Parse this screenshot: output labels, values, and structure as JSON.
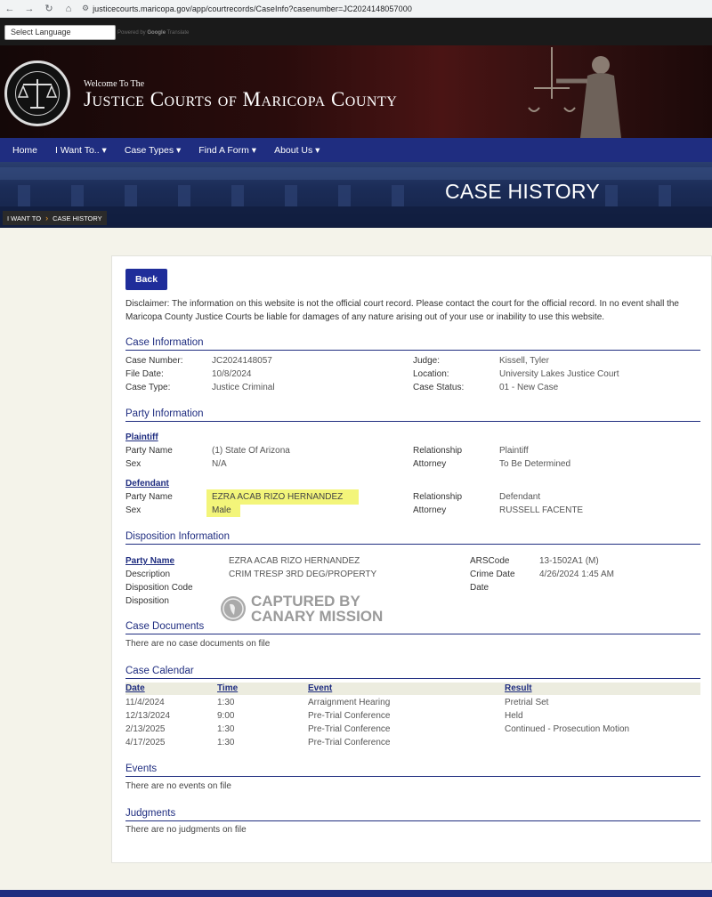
{
  "browser": {
    "url": "justicecourts.maricopa.gov/app/courtrecords/CaseInfo?casenumber=JC2024148057000"
  },
  "translate": {
    "select_label": "Select Language",
    "powered_by": "Powered by",
    "google": "Google",
    "translate": "Translate"
  },
  "header": {
    "welcome": "Welcome To The",
    "title": "Justice Courts of Maricopa County"
  },
  "nav": {
    "items": [
      "Home",
      "I Want To.. ▾",
      "Case Types ▾",
      "Find A Form ▾",
      "About Us ▾"
    ]
  },
  "banner": {
    "title": "CASE HISTORY",
    "breadcrumb": [
      "I WANT TO",
      "CASE HISTORY"
    ]
  },
  "page": {
    "back_label": "Back",
    "disclaimer": "Disclaimer: The information on this website is not the official court record. Please contact the court for the official record. In no event shall the Maricopa County Justice Courts be liable for damages of any nature arising out of your use or inability to use this website."
  },
  "case_info": {
    "title": "Case Information",
    "case_number_label": "Case Number:",
    "case_number": "JC2024148057",
    "file_date_label": "File Date:",
    "file_date": "10/8/2024",
    "case_type_label": "Case Type:",
    "case_type": "Justice Criminal",
    "judge_label": "Judge:",
    "judge": "Kissell, Tyler",
    "location_label": "Location:",
    "location": "University Lakes Justice Court",
    "status_label": "Case Status:",
    "status": "01 - New Case"
  },
  "party_info": {
    "title": "Party Information",
    "plaintiff": {
      "heading": "Plaintiff",
      "party_name_label": "Party Name",
      "party_name": "(1) State Of Arizona",
      "sex_label": "Sex",
      "sex": "N/A",
      "relationship_label": "Relationship",
      "relationship": "Plaintiff",
      "attorney_label": "Attorney",
      "attorney": "To Be Determined"
    },
    "defendant": {
      "heading": "Defendant",
      "party_name_label": "Party Name",
      "party_name": "EZRA ACAB RIZO HERNANDEZ",
      "sex_label": "Sex",
      "sex": "Male",
      "relationship_label": "Relationship",
      "relationship": "Defendant",
      "attorney_label": "Attorney",
      "attorney": "RUSSELL FACENTE"
    }
  },
  "disposition": {
    "title": "Disposition Information",
    "party_name_label": "Party Name",
    "party_name": "EZRA ACAB RIZO HERNANDEZ",
    "description_label": "Description",
    "description": "CRIM TRESP 3RD DEG/PROPERTY",
    "code_label": "Disposition Code",
    "disposition_label": "Disposition",
    "ars_label": "ARSCode",
    "ars": "13-1502A1 (M)",
    "crime_date_label": "Crime Date",
    "crime_date": "4/26/2024 1:45 AM",
    "date_label": "Date"
  },
  "watermark": {
    "line1": "CAPTURED BY",
    "line2": "CANARY MISSION"
  },
  "documents": {
    "title": "Case Documents",
    "empty": "There are no case documents on file"
  },
  "calendar": {
    "title": "Case Calendar",
    "headers": [
      "Date",
      "Time",
      "Event",
      "Result"
    ],
    "rows": [
      [
        "11/4/2024",
        "1:30",
        "Arraignment Hearing",
        "Pretrial Set"
      ],
      [
        "12/13/2024",
        "9:00",
        "Pre-Trial Conference",
        "Held"
      ],
      [
        "2/13/2025",
        "1:30",
        "Pre-Trial Conference",
        "Continued - Prosecution Motion"
      ],
      [
        "4/17/2025",
        "1:30",
        "Pre-Trial Conference",
        ""
      ]
    ]
  },
  "events": {
    "title": "Events",
    "empty": "There are no events on file"
  },
  "judgments": {
    "title": "Judgments",
    "empty": "There are no judgments on file"
  },
  "colors": {
    "nav_blue": "#1f2d80",
    "button_blue": "#1f2d9a",
    "highlight": "#f3f57a",
    "page_bg": "#f4f3ea"
  }
}
